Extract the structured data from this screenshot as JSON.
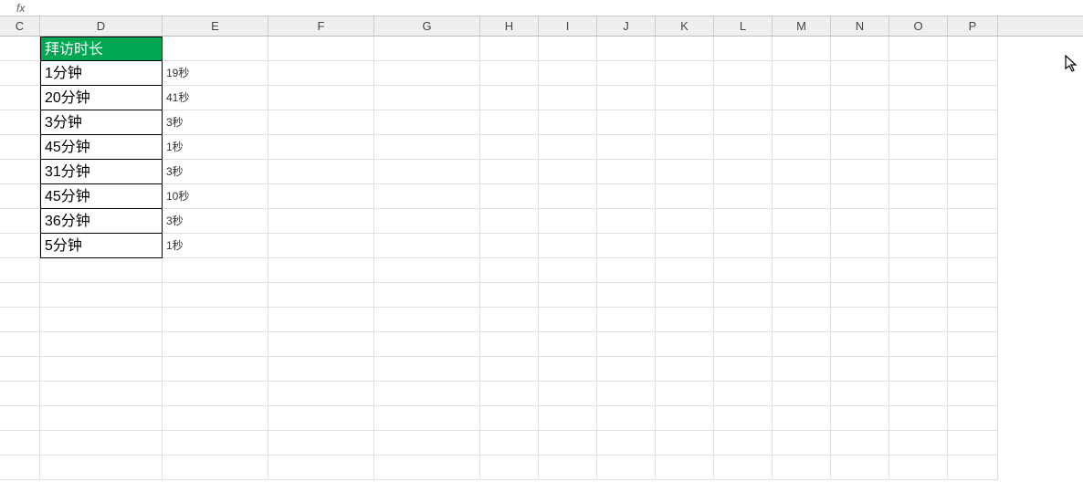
{
  "formula_bar": {
    "label": "fx"
  },
  "columns": [
    {
      "label": "C",
      "width": 44
    },
    {
      "label": "D",
      "width": 134
    },
    {
      "label": "E",
      "width": 116
    },
    {
      "label": "F",
      "width": 116
    },
    {
      "label": "G",
      "width": 116
    },
    {
      "label": "H",
      "width": 64
    },
    {
      "label": "I",
      "width": 64
    },
    {
      "label": "J",
      "width": 64
    },
    {
      "label": "K",
      "width": 64
    },
    {
      "label": "L",
      "width": 64
    },
    {
      "label": "M",
      "width": 64
    },
    {
      "label": "N",
      "width": 64
    },
    {
      "label": "O",
      "width": 64
    },
    {
      "label": "P",
      "width": 55
    }
  ],
  "header": {
    "d": "拜访时长"
  },
  "data_rows": [
    {
      "d": "1分钟",
      "e": "19秒"
    },
    {
      "d": "20分钟",
      "e": "41秒"
    },
    {
      "d": "3分钟",
      "e": "3秒"
    },
    {
      "d": "45分钟",
      "e": "1秒"
    },
    {
      "d": "31分钟",
      "e": "3秒"
    },
    {
      "d": "45分钟",
      "e": "10秒"
    },
    {
      "d": "36分钟",
      "e": "3秒"
    },
    {
      "d": "5分钟",
      "e": "1秒"
    }
  ],
  "empty_rows": 9
}
